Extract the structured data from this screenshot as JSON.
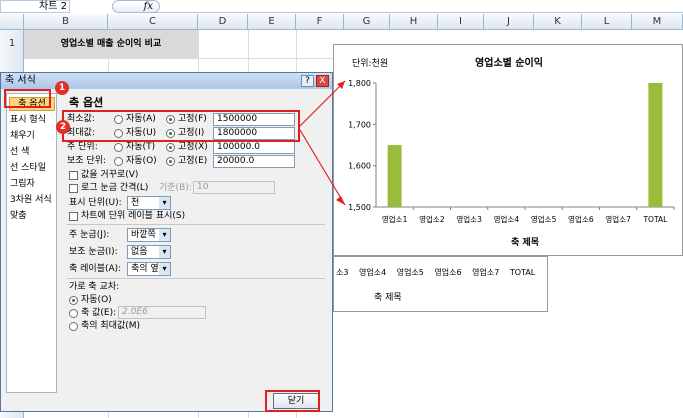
{
  "formula_bar": {
    "name_box": "차트 2",
    "fx_label": "fx"
  },
  "sheet": {
    "columns": [
      "B",
      "C",
      "D",
      "E",
      "F",
      "G",
      "H",
      "I",
      "J",
      "K",
      "L",
      "M"
    ],
    "row_number": "1",
    "cell_title": "영업소별 매출 순이익 비교"
  },
  "dialog": {
    "title": "축 서식",
    "help_label": "?",
    "close_x_label": "X",
    "left_items": [
      "축 옵션",
      "표시 형식",
      "채우기",
      "선 색",
      "선 스타일",
      "그림자",
      "3차원 서식",
      "맞춤"
    ],
    "section_title": "축 옵션",
    "rows": {
      "min": {
        "label": "최소값:",
        "auto": "자동(A)",
        "fixed": "고정(F)",
        "value": "1500000"
      },
      "max": {
        "label": "최대값:",
        "auto": "자동(U)",
        "fixed": "고정(I)",
        "value": "1800000"
      },
      "major": {
        "label": "주 단위:",
        "auto": "자동(T)",
        "fixed": "고정(X)",
        "value": "100000.0"
      },
      "minor": {
        "label": "보조 단위:",
        "auto": "자동(O)",
        "fixed": "고정(E)",
        "value": "20000.0"
      }
    },
    "reverse_label": "값을 거꾸로(V)",
    "log_label": "로그 눈금 간격(L)",
    "log_base_label": "기준(B):",
    "log_base_value": "10",
    "display_units_label": "표시 단위(U):",
    "display_units_value": "천",
    "show_units_label": "차트에 단위 레이블 표시(S)",
    "major_tick_label": "주 눈금(J):",
    "major_tick_value": "바깥쪽",
    "minor_tick_label": "보조 눈금(I):",
    "minor_tick_value": "없음",
    "axis_labels_label": "축 레이블(A):",
    "axis_labels_value": "축의 옆",
    "cross_title": "가로 축 교차:",
    "cross_auto": "자동(O)",
    "cross_value_label": "축 값(E):",
    "cross_value": "2.0E6",
    "cross_max": "축의 최대값(M)",
    "close_button": "닫기",
    "badges": [
      "1",
      "2"
    ]
  },
  "chart_behind": {
    "tick_labels": [
      "소3",
      "영업소4",
      "영업소5",
      "영업소6",
      "영업소7",
      "TOTAL"
    ],
    "xlabel": "축 제목"
  },
  "chart_data": {
    "type": "bar",
    "title": "영업소별 순이익",
    "unit_label": "단위:천원",
    "xlabel": "축 제목",
    "categories": [
      "영업소1",
      "영업소2",
      "영업소3",
      "영업소4",
      "영업소5",
      "영업소6",
      "영업소7",
      "TOTAL"
    ],
    "values": [
      1650,
      null,
      null,
      null,
      null,
      null,
      null,
      1800
    ],
    "y_ticks": [
      "1,800",
      "1,700",
      "1,600",
      "1,500"
    ],
    "ylim": [
      1500,
      1800
    ],
    "grid": false,
    "bar_color": "#9bbb3a"
  },
  "colors": {
    "highlight": "#e02020",
    "titlebar": "#aac6e9",
    "selected_item": "#ffd47a"
  }
}
